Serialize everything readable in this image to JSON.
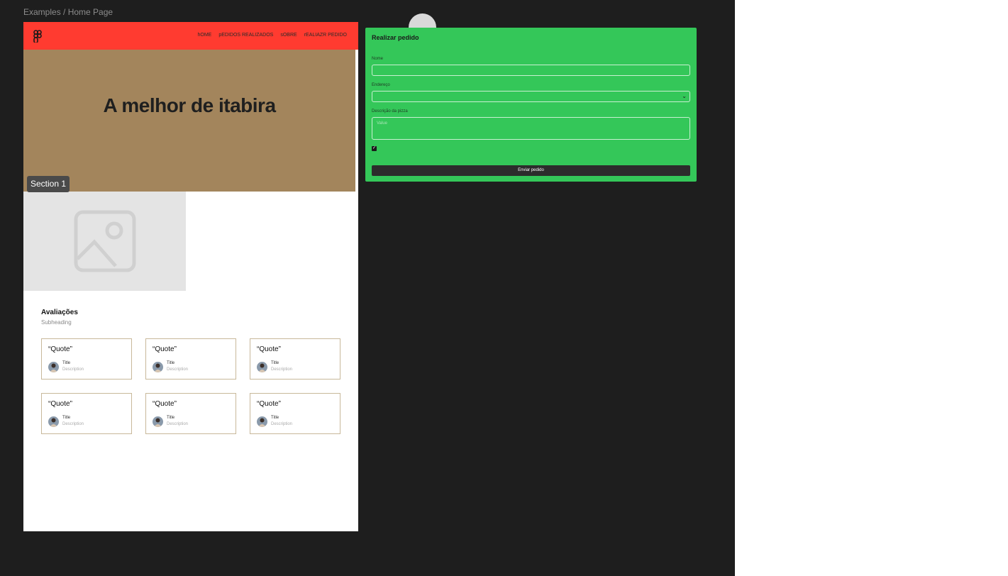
{
  "breadcrumb": "Examples / Home Page",
  "navbar": {
    "links": [
      "hOME",
      "pEDIDOS REALIZADOS",
      "sOBRE",
      "rEALIAZR  PEDIDO"
    ],
    "color": "#ff3b30"
  },
  "hero": {
    "title": "A melhor de itabira",
    "color": "#a3855c"
  },
  "section_tag": "Section 1",
  "reviews": {
    "heading": "Avaliações",
    "subheading": "Subheading",
    "cards": [
      {
        "quote": "“Quote”",
        "title": "Title",
        "description": "Description"
      },
      {
        "quote": "“Quote”",
        "title": "Title",
        "description": "Description"
      },
      {
        "quote": "“Quote”",
        "title": "Title",
        "description": "Description"
      },
      {
        "quote": "“Quote”",
        "title": "Title",
        "description": "Description"
      },
      {
        "quote": "“Quote”",
        "title": "Title",
        "description": "Description"
      },
      {
        "quote": "“Quote”",
        "title": "Title",
        "description": "Description"
      }
    ]
  },
  "form": {
    "title": "Realizar pedido",
    "name_label": "Nome",
    "address_label": "Endereço",
    "description_label": "Descrição da pizza",
    "description_placeholder": "Value",
    "checkbox_checked": true,
    "submit_label": "Enviar pedido",
    "color": "#34c759"
  }
}
